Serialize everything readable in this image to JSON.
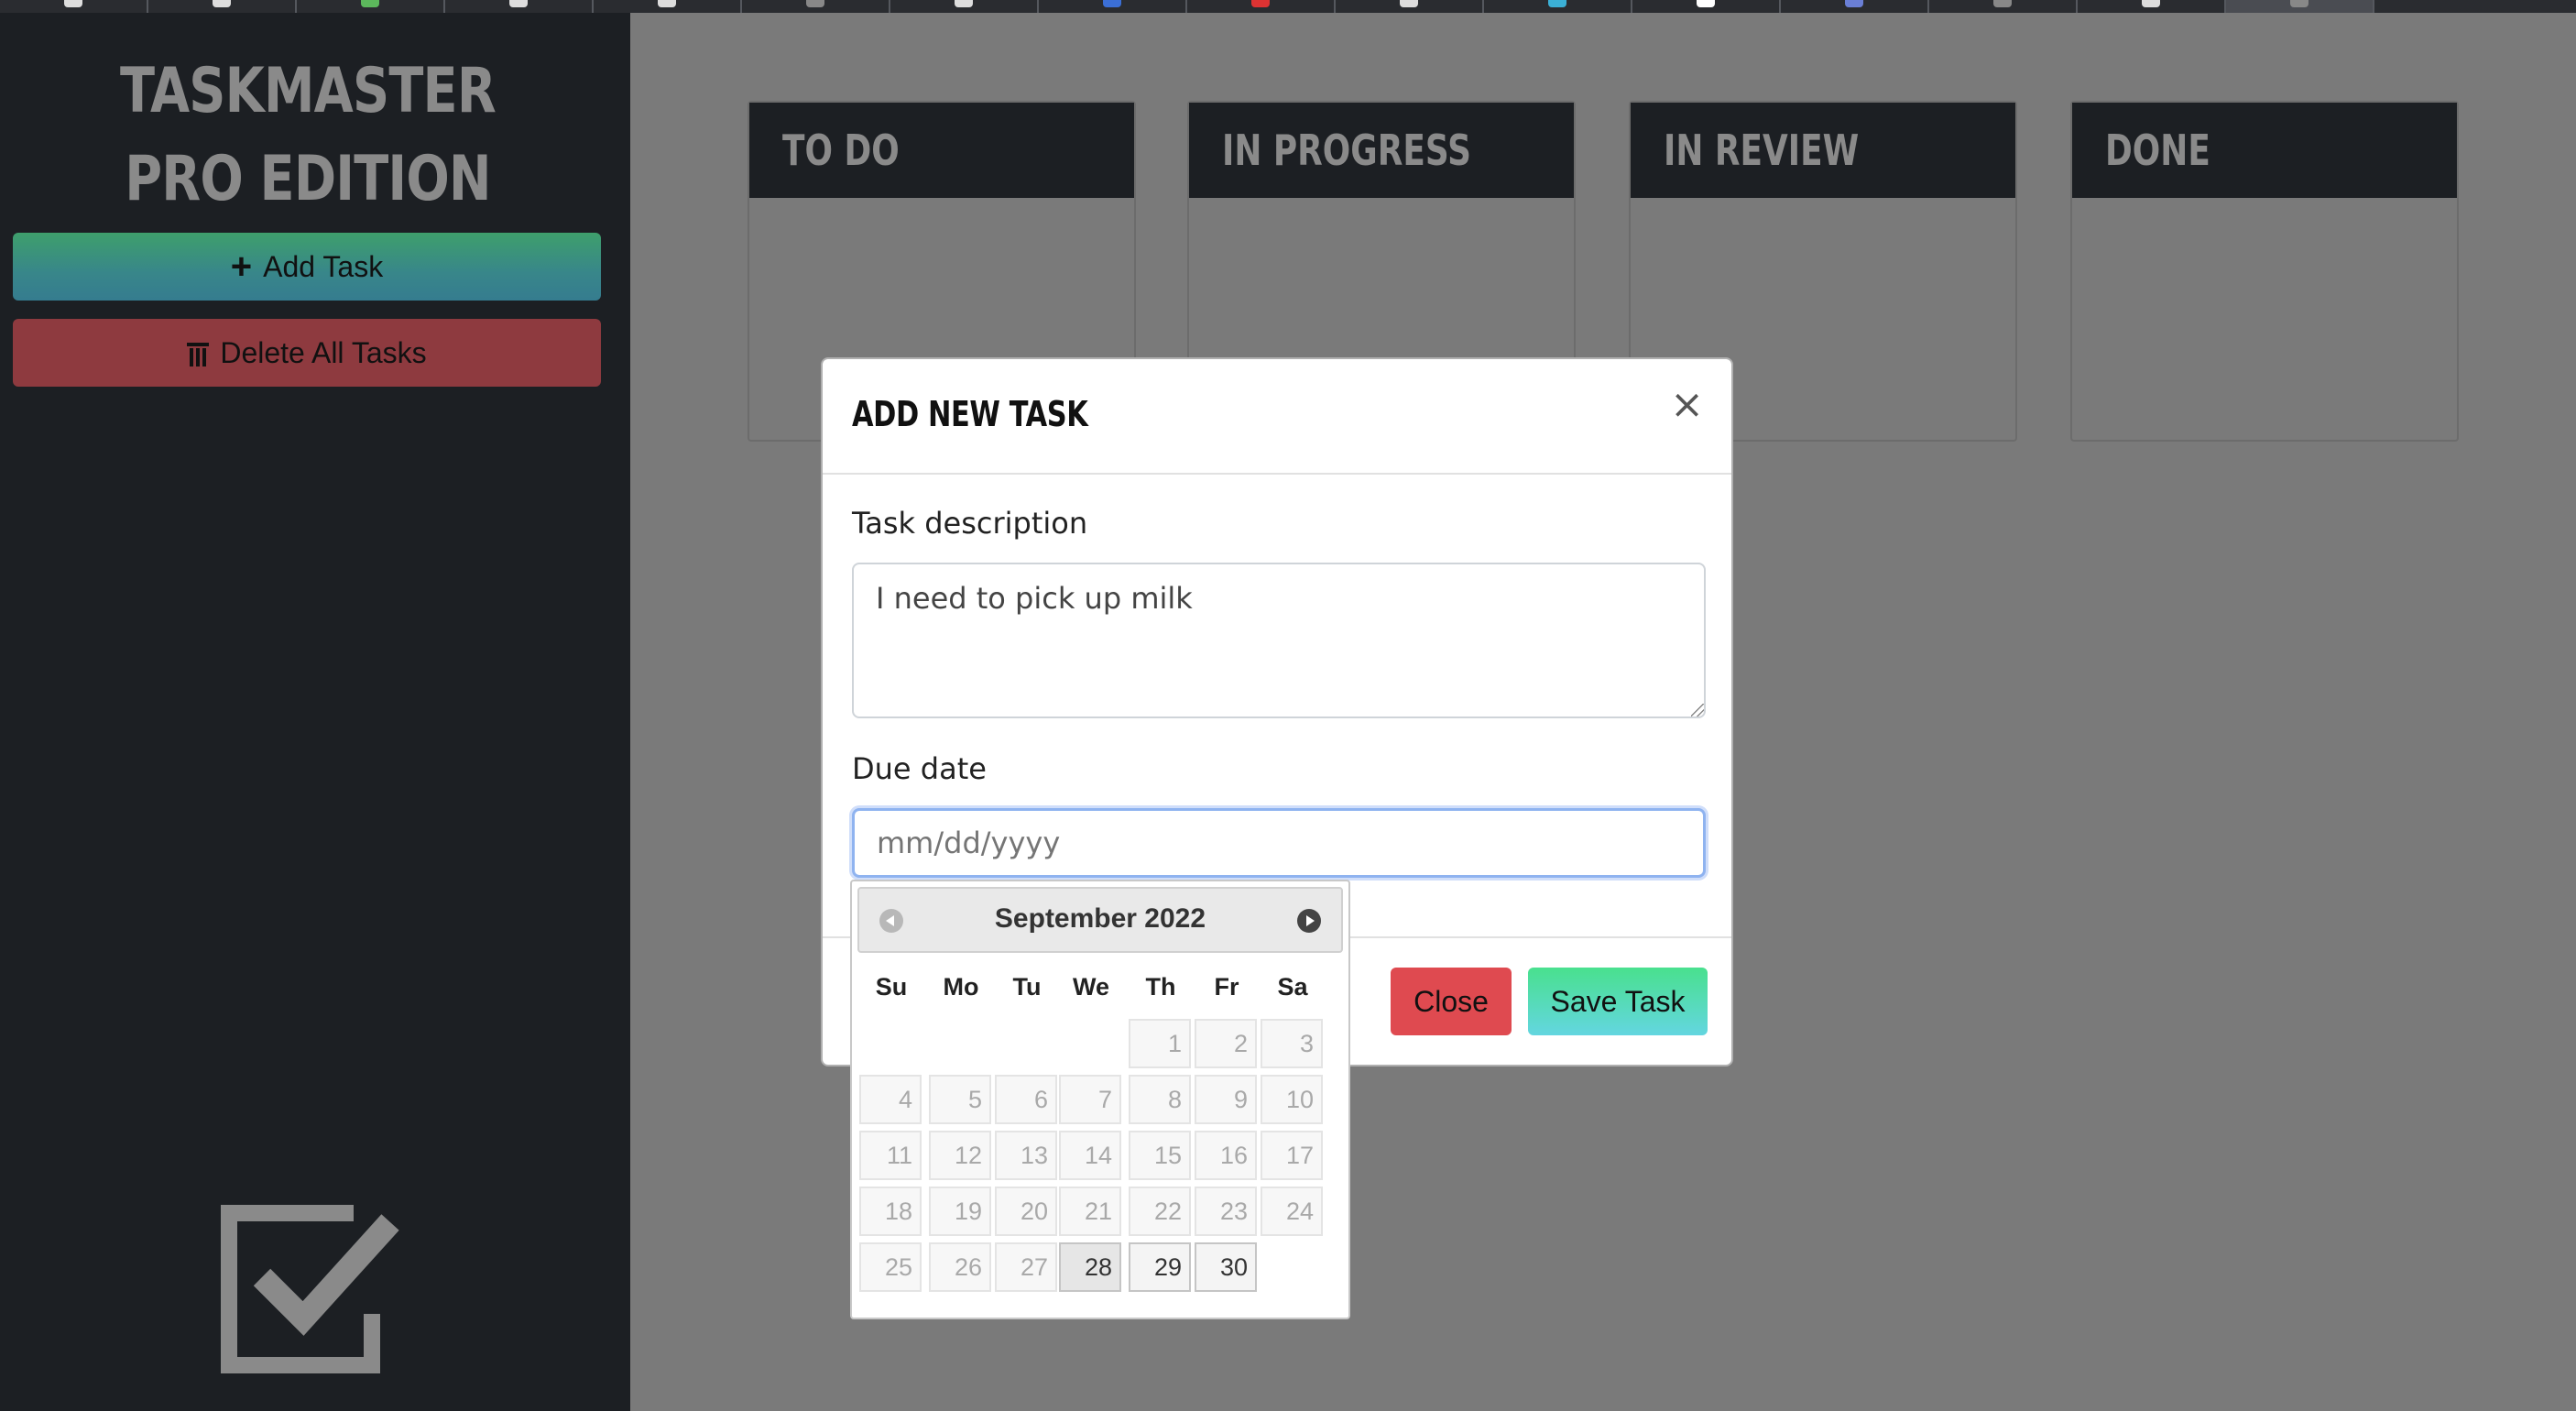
{
  "sidebar": {
    "title": "TASKMASTER PRO EDITION",
    "add_task_label": "Add Task",
    "delete_all_label": "Delete All Tasks",
    "logo_icon": "checkbox-checked-icon",
    "colors": {
      "add_gradient_top": "#3e9f6c",
      "add_gradient_bottom": "#357c8f",
      "delete": "#8e3a3f",
      "background": "#1c1f23"
    }
  },
  "board": {
    "columns": [
      {
        "title": "TO DO"
      },
      {
        "title": "IN PROGRESS"
      },
      {
        "title": "IN REVIEW"
      },
      {
        "title": "DONE"
      }
    ]
  },
  "modal": {
    "title": "ADD NEW TASK",
    "close_symbol": "×",
    "description_label": "Task description",
    "description_value": "I need to pick up milk",
    "due_date_label": "Due date",
    "due_date_placeholder": "mm/dd/yyyy",
    "close_button": "Close",
    "save_button": "Save Task",
    "colors": {
      "close_button": "#df4a50",
      "save_gradient_top": "#49e08e",
      "save_gradient_bottom": "#63d6e0"
    }
  },
  "datepicker": {
    "month_year": "September 2022",
    "weekdays": [
      "Su",
      "Mo",
      "Tu",
      "We",
      "Th",
      "Fr",
      "Sa"
    ],
    "weeks": [
      [
        "",
        "",
        "",
        "",
        "1",
        "2",
        "3"
      ],
      [
        "4",
        "5",
        "6",
        "7",
        "8",
        "9",
        "10"
      ],
      [
        "11",
        "12",
        "13",
        "14",
        "15",
        "16",
        "17"
      ],
      [
        "18",
        "19",
        "20",
        "21",
        "22",
        "23",
        "24"
      ],
      [
        "25",
        "26",
        "27",
        "28",
        "29",
        "30",
        ""
      ]
    ],
    "enabled_days": [
      "28",
      "29",
      "30"
    ],
    "highlighted_day": "28",
    "prev_icon": "chevron-left-circle-icon",
    "next_icon": "chevron-right-circle-icon"
  }
}
